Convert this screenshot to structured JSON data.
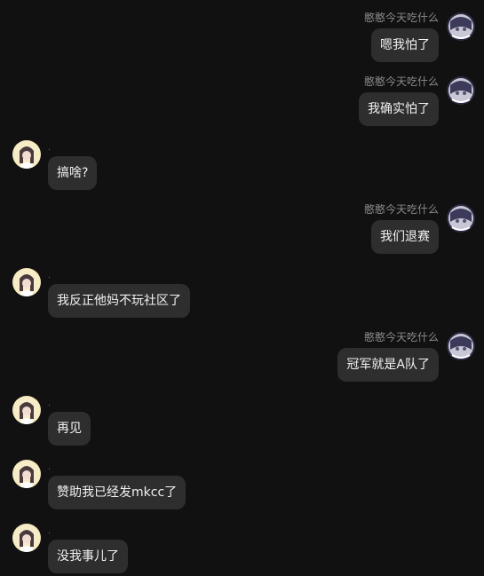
{
  "messages": [
    {
      "side": "right",
      "name": "憨憨今天吃什么",
      "text": "嗯我怕了"
    },
    {
      "side": "right",
      "name": "憨憨今天吃什么",
      "text": "我确实怕了"
    },
    {
      "side": "left",
      "name": ".",
      "text": "搞啥?"
    },
    {
      "side": "right",
      "name": "憨憨今天吃什么",
      "text": "我们退赛"
    },
    {
      "side": "left",
      "name": ".",
      "text": "我反正他妈不玩社区了"
    },
    {
      "side": "right",
      "name": "憨憨今天吃什么",
      "text": "冠军就是A队了"
    },
    {
      "side": "left",
      "name": ".",
      "text": "再见"
    },
    {
      "side": "left",
      "name": ".",
      "text": "赞助我已经发mkcc了"
    },
    {
      "side": "left",
      "name": ".",
      "text": "没我事儿了"
    }
  ],
  "colors": {
    "background": "#111111",
    "bubble": "#2e2e2e",
    "name_text": "#8a8a8a"
  }
}
